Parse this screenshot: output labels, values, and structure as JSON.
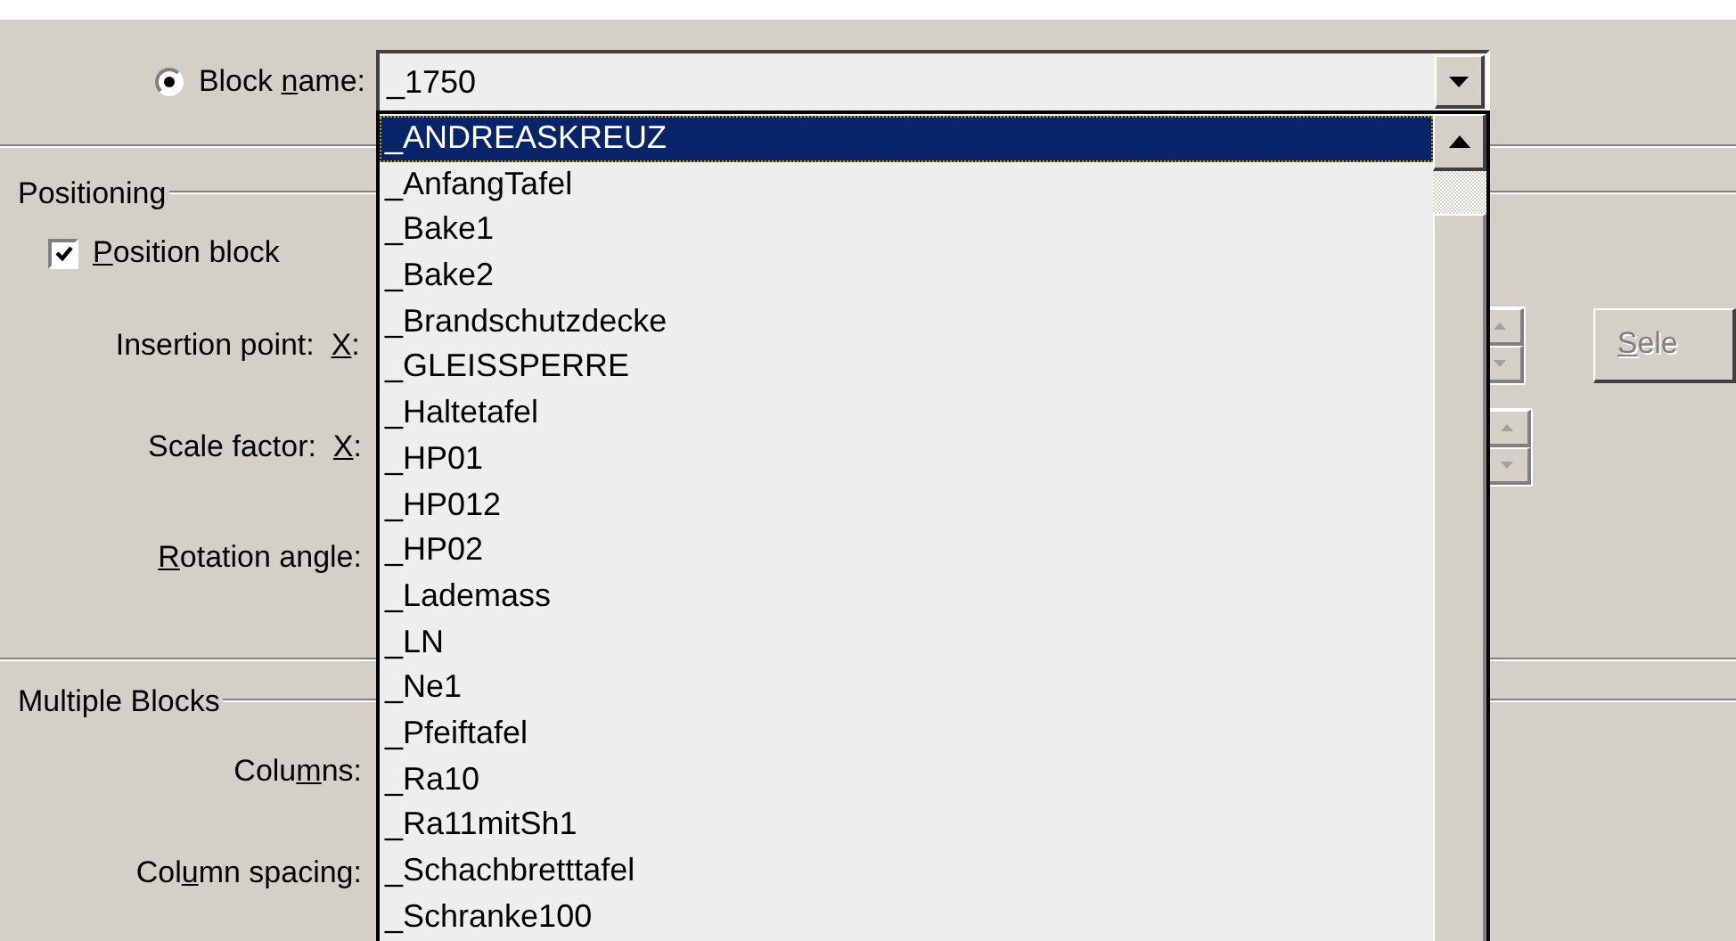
{
  "block_name": {
    "selected": true,
    "label": {
      "before": "Block ",
      "key": "n",
      "after": "ame:"
    },
    "value": "_1750"
  },
  "positioning": {
    "title": "Positioning",
    "checkbox": {
      "label": {
        "key": "P",
        "after": "osition block"
      },
      "checked": true
    },
    "fields": [
      {
        "label": {
          "before": "Insertion point:  ",
          "key": "X",
          "after": ":"
        },
        "spinner": true
      },
      {
        "label": {
          "before": "Scale factor:  ",
          "key": "X",
          "after": ":"
        },
        "spinner": true
      },
      {
        "label": {
          "key": "R",
          "after": "otation angle:"
        },
        "spinner": false
      }
    ],
    "select_button": {
      "label": {
        "key": "S",
        "after": "ele"
      },
      "disabled": true
    }
  },
  "multiple_blocks": {
    "title": "Multiple Blocks",
    "fields": [
      {
        "label": {
          "before": "Colu",
          "key": "m",
          "after": "ns:"
        }
      },
      {
        "label": {
          "before": "Col",
          "key": "u",
          "after": "mn spacing:"
        }
      }
    ]
  },
  "dropdown": {
    "items": [
      {
        "text": "_ANDREASKREUZ",
        "selected": true
      },
      {
        "text": "_AnfangTafel",
        "selected": false
      },
      {
        "text": "_Bake1",
        "selected": false
      },
      {
        "text": "_Bake2",
        "selected": false
      },
      {
        "text": "_Brandschutzdecke",
        "selected": false
      },
      {
        "text": "_GLEISSPERRE",
        "selected": false
      },
      {
        "text": "_Haltetafel",
        "selected": false
      },
      {
        "text": "_HP01",
        "selected": false
      },
      {
        "text": "_HP012",
        "selected": false
      },
      {
        "text": "_HP02",
        "selected": false
      },
      {
        "text": "_Lademass",
        "selected": false
      },
      {
        "text": "_LN",
        "selected": false
      },
      {
        "text": "_Ne1",
        "selected": false
      },
      {
        "text": "_Pfeiftafel",
        "selected": false
      },
      {
        "text": "_Ra10",
        "selected": false
      },
      {
        "text": "_Ra11mitSh1",
        "selected": false
      },
      {
        "text": "_Schachbretttafel",
        "selected": false
      },
      {
        "text": "_Schranke100",
        "selected": false
      }
    ]
  }
}
